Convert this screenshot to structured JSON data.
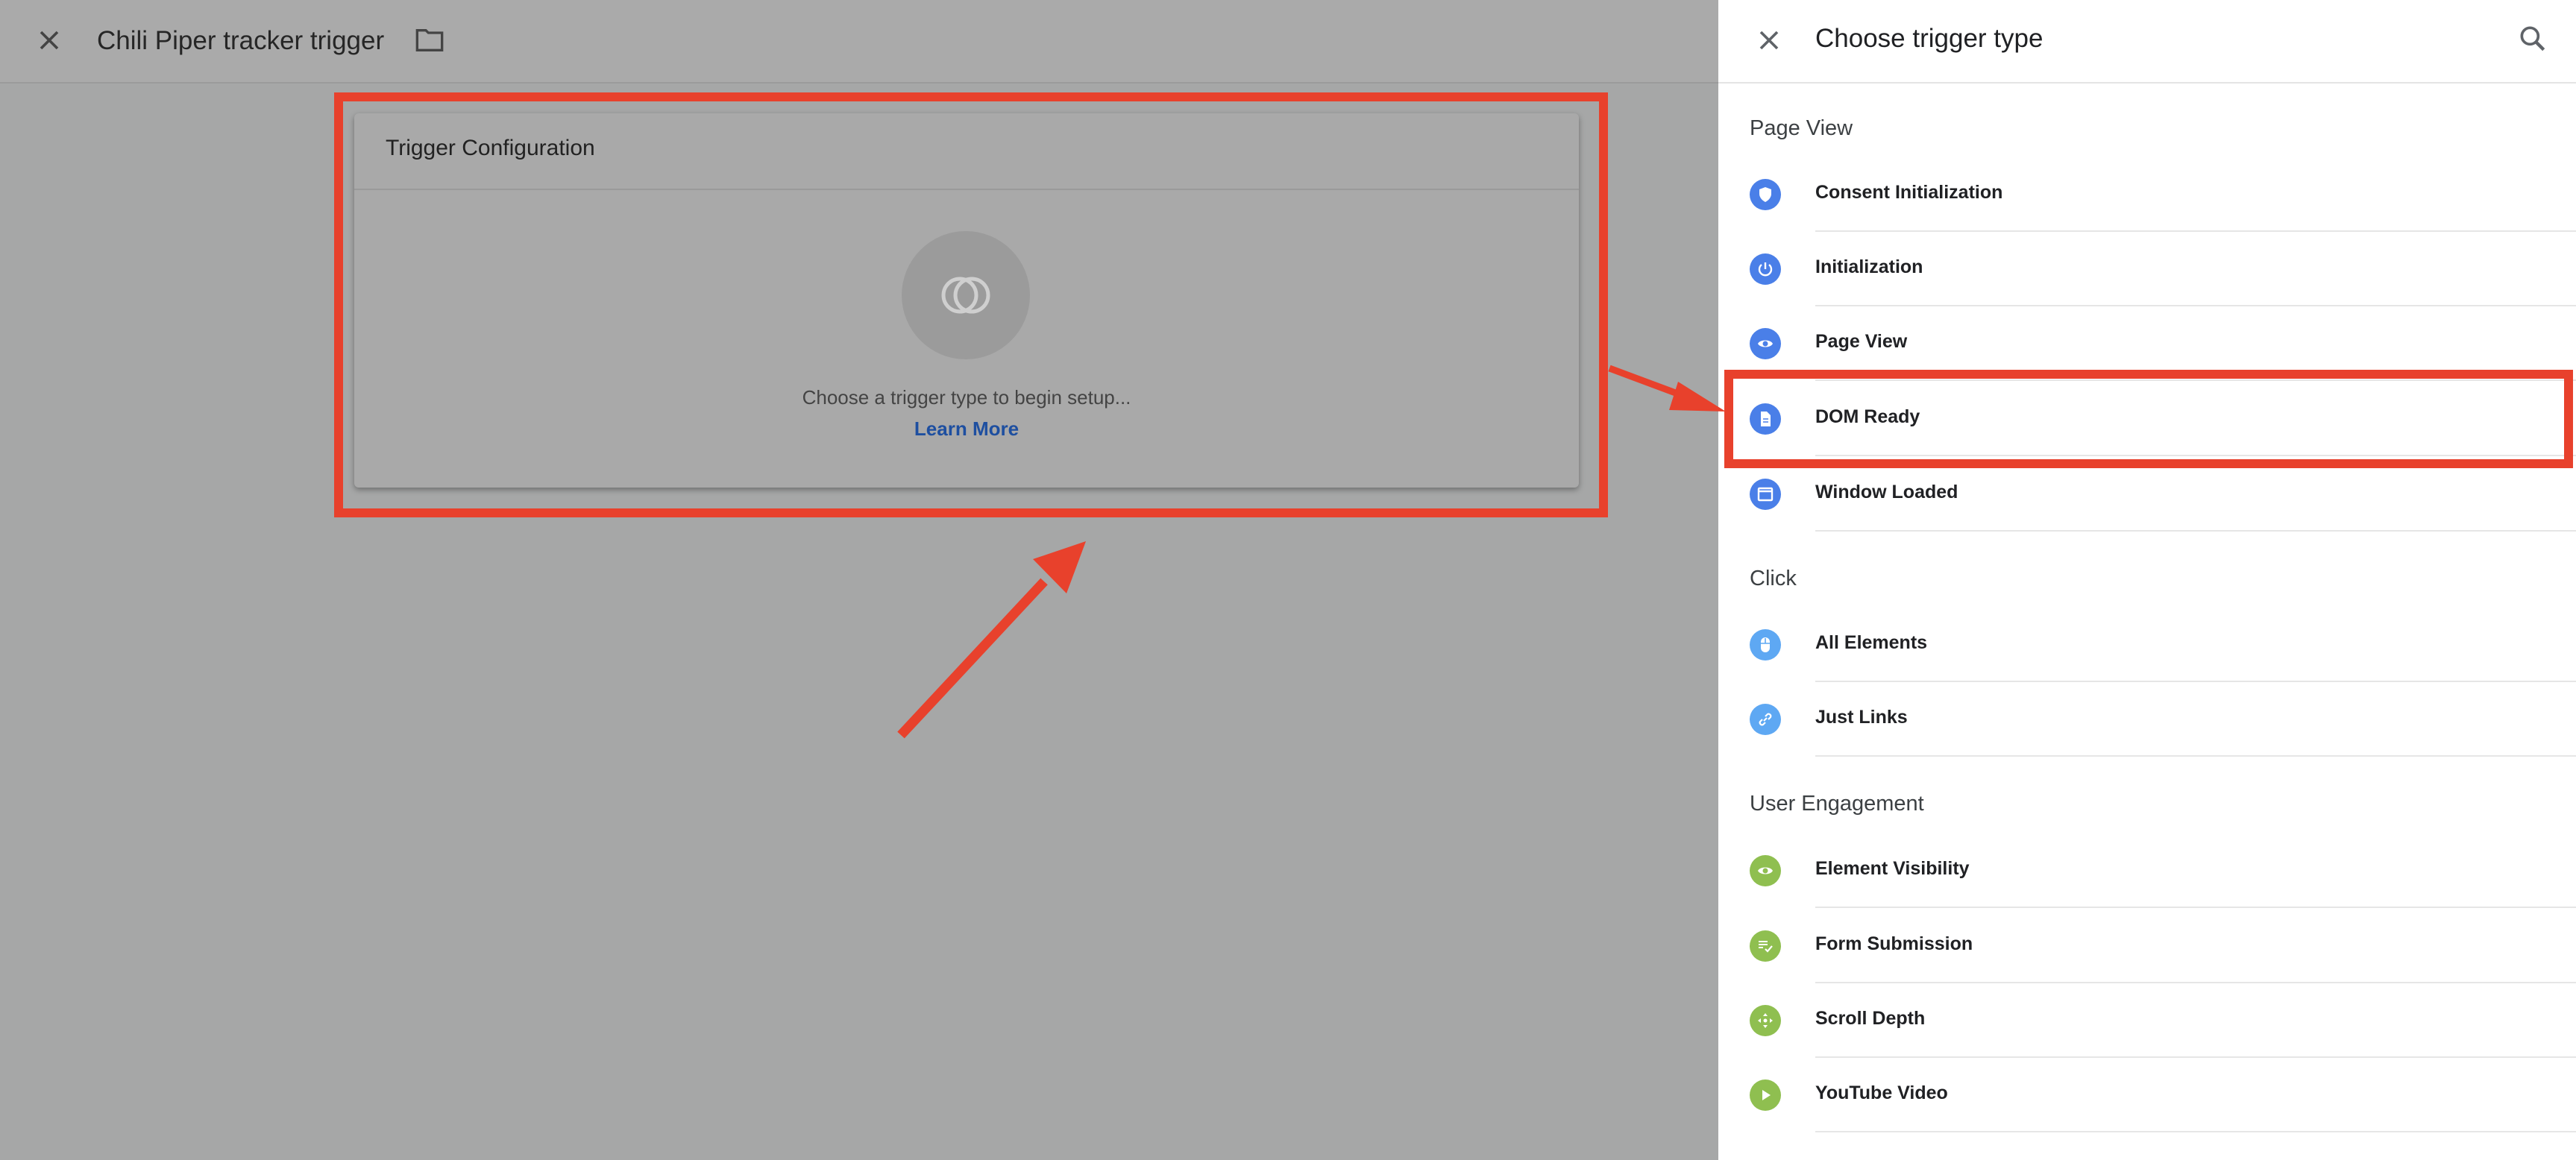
{
  "editor": {
    "trigger_name": "Chili Piper tracker trigger",
    "config_card": {
      "title": "Trigger Configuration",
      "hint": "Choose a trigger type to begin setup...",
      "learn_more": "Learn More"
    }
  },
  "panel": {
    "title": "Choose trigger type",
    "sections": [
      {
        "title": "Page View",
        "items": [
          {
            "label": "Consent Initialization",
            "icon": "shield-icon"
          },
          {
            "label": "Initialization",
            "icon": "power-icon"
          },
          {
            "label": "Page View",
            "icon": "eye-icon"
          },
          {
            "label": "DOM Ready",
            "icon": "document-icon"
          },
          {
            "label": "Window Loaded",
            "icon": "window-icon"
          }
        ]
      },
      {
        "title": "Click",
        "items": [
          {
            "label": "All Elements",
            "icon": "mouse-icon"
          },
          {
            "label": "Just Links",
            "icon": "link-icon"
          }
        ]
      },
      {
        "title": "User Engagement",
        "items": [
          {
            "label": "Element Visibility",
            "icon": "eye-icon"
          },
          {
            "label": "Form Submission",
            "icon": "form-check-icon"
          },
          {
            "label": "Scroll Depth",
            "icon": "scroll-arrows-icon"
          },
          {
            "label": "YouTube Video",
            "icon": "play-icon"
          }
        ]
      }
    ]
  },
  "colors": {
    "annotation": "#e8412c",
    "page_view_icon": "#4a7fe8",
    "click_icon": "#5ea8f3",
    "engagement_icon": "#8fbf50",
    "link": "#1e4fa0"
  }
}
